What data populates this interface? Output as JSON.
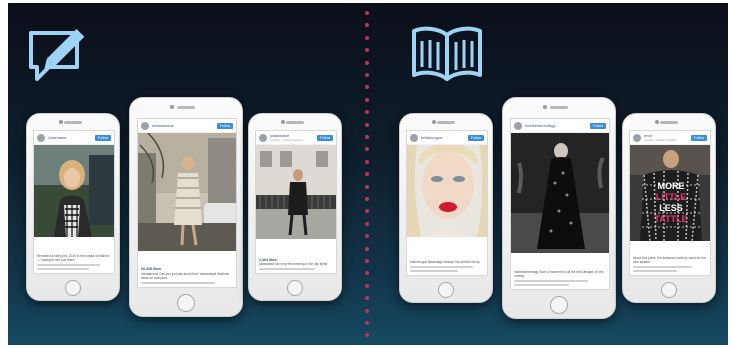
{
  "colors": {
    "accent_icon": "#9ed3f5",
    "divider": "#c0315a",
    "follow": "#3b8fd8"
  },
  "left_section": {
    "icon": "pencil-speech-bubble-icon"
  },
  "right_section": {
    "icon": "open-book-icon"
  },
  "phones": [
    {
      "username": "Username",
      "location": "",
      "follow_label": "Follow",
      "likes": "",
      "caption": "Revealed a rolling trip 2016 to the capital of fashion — hoping to see you there"
    },
    {
      "username": "instafamous",
      "location": "",
      "follow_label": "Follow",
      "likes": "20,435 likes",
      "caption": "instafamous Can you just talk about this? #streetstyle #fashion ideas for everyone"
    },
    {
      "username": "juliaswaise",
      "location": "London, United Kingdom",
      "follow_label": "Follow",
      "likes": "2,364 likes",
      "caption": "juliaswaise My very first evening in the city lights"
    },
    {
      "username": "britishvogue",
      "location": "",
      "follow_label": "Follow",
      "likes": "",
      "caption": "britishvogue Backstage beauty: the perfect red lip"
    },
    {
      "username": "marikelamentagy",
      "location": "",
      "follow_label": "Follow",
      "likes": "",
      "caption": "marikelamentagy Such a moment for all the wild designs on the runway"
    },
    {
      "username": "nhrd",
      "location": "London, United Kingdom",
      "follow_label": "Follow",
      "likes": "",
      "caption": "About this piece, the knitwear made by hand for the new season"
    }
  ],
  "sweater_text": [
    "MORE",
    "LITTLE",
    "LESS",
    "TATTLE"
  ]
}
